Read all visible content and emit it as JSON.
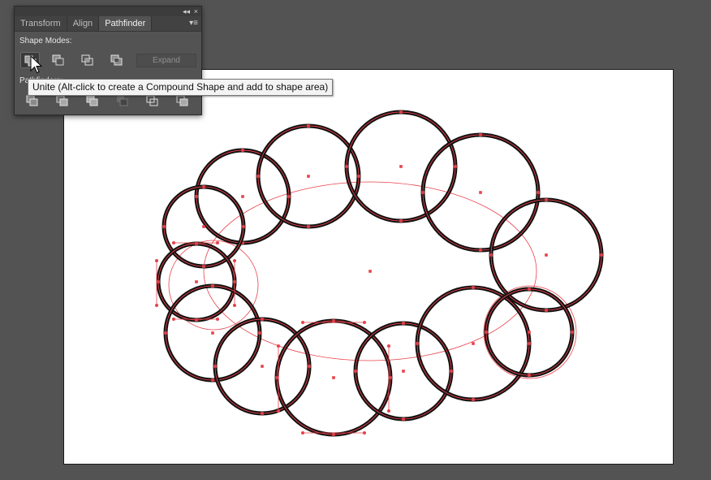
{
  "panel": {
    "tabs": [
      {
        "label": "Transform"
      },
      {
        "label": "Align"
      },
      {
        "label": "Pathfinder",
        "active": true
      }
    ],
    "collapse_glyph": "◂◂",
    "close_glyph": "×",
    "menu_glyph": "▾≡",
    "shape_modes_label": "Shape Modes:",
    "pathfinders_label": "Pathfinders:",
    "expand_label": "Expand",
    "shape_mode_buttons": [
      "unite-icon",
      "minus-front-icon",
      "intersect-icon",
      "exclude-icon"
    ],
    "pathfinder_buttons": [
      "divide-icon",
      "trim-icon",
      "merge-icon",
      "crop-icon",
      "outline-icon",
      "minus-back-icon"
    ]
  },
  "tooltip": {
    "text": "Unite (Alt-click to create a Compound Shape and add to shape area)"
  },
  "colors": {
    "workspace_bg": "#535353",
    "artboard": "#ffffff",
    "stroke": "#111111",
    "selection": "#e8414a"
  }
}
